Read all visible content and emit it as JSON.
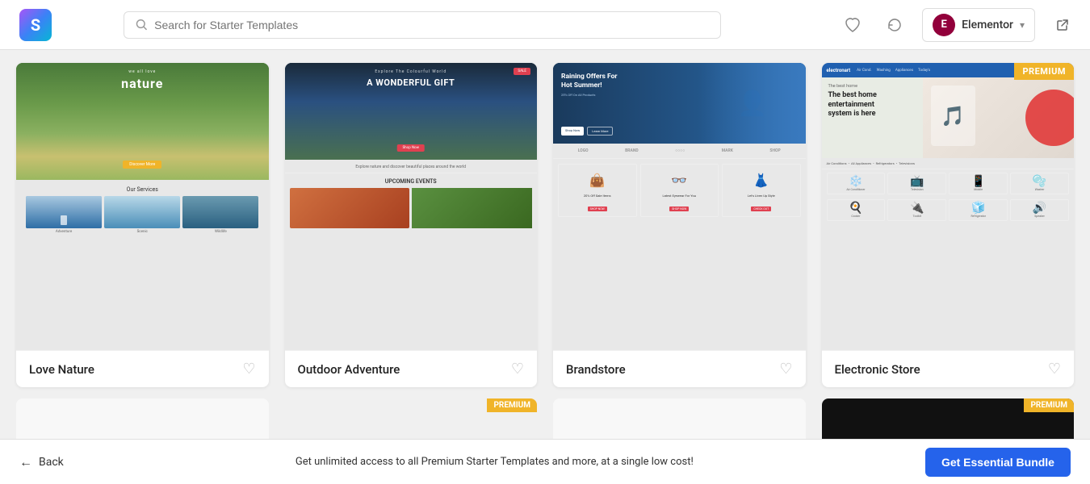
{
  "topbar": {
    "search_placeholder": "Search for Starter Templates",
    "elementor_label": "Elementor",
    "elementor_initial": "E"
  },
  "templates": [
    {
      "id": "love-nature",
      "name": "Love Nature",
      "premium": false,
      "hero_line1": "we all love",
      "hero_line2": "nature",
      "services_title": "Our Services"
    },
    {
      "id": "outdoor-adventure",
      "name": "Outdoor Adventure",
      "premium": false,
      "hero_sub": "Explore The Colourful World",
      "hero_main": "A WONDERFUL GIFT",
      "events_title": "UPCOMING EVENTS"
    },
    {
      "id": "brandstore",
      "name": "Brandstore",
      "premium": false,
      "hero_main": "Raining Offers For Hot Summer!",
      "hero_sub": "25% Off On All Products"
    },
    {
      "id": "electronic-store",
      "name": "Electronic Store",
      "premium": true,
      "hero_title": "The best home entertainment system is here",
      "nav_logo": "electronart"
    }
  ],
  "bottom": {
    "back_label": "Back",
    "promo_text": "Get unlimited access to all Premium Starter Templates and more, at a single low cost!",
    "bundle_btn": "Get Essential Bundle"
  },
  "premium_label": "PREMIUM"
}
